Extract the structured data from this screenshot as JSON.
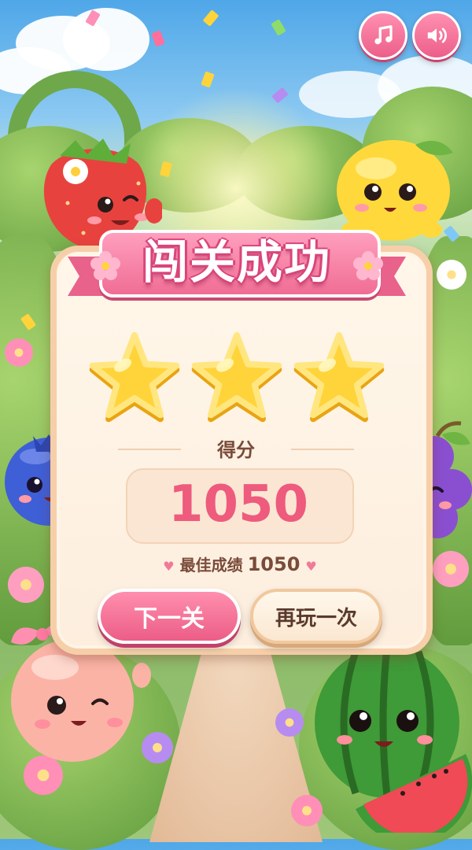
{
  "header": {
    "music_icon": "music-note-icon",
    "sound_icon": "speaker-icon"
  },
  "result": {
    "title": "闯关成功",
    "stars_earned": 3,
    "stars_total": 3,
    "score_label": "得分",
    "score_value": "1050",
    "best_label": "最佳成绩",
    "best_value": "1050"
  },
  "buttons": {
    "next_label": "下一关",
    "replay_label": "再玩一次"
  },
  "colors": {
    "accent_pink": "#ee5b7d",
    "star_yellow": "#ffd43b",
    "panel_cream": "#fff7ea",
    "panel_border": "#f6cfa9"
  },
  "characters": [
    "strawberry",
    "lemon",
    "blueberry",
    "grape",
    "peach",
    "watermelon"
  ]
}
